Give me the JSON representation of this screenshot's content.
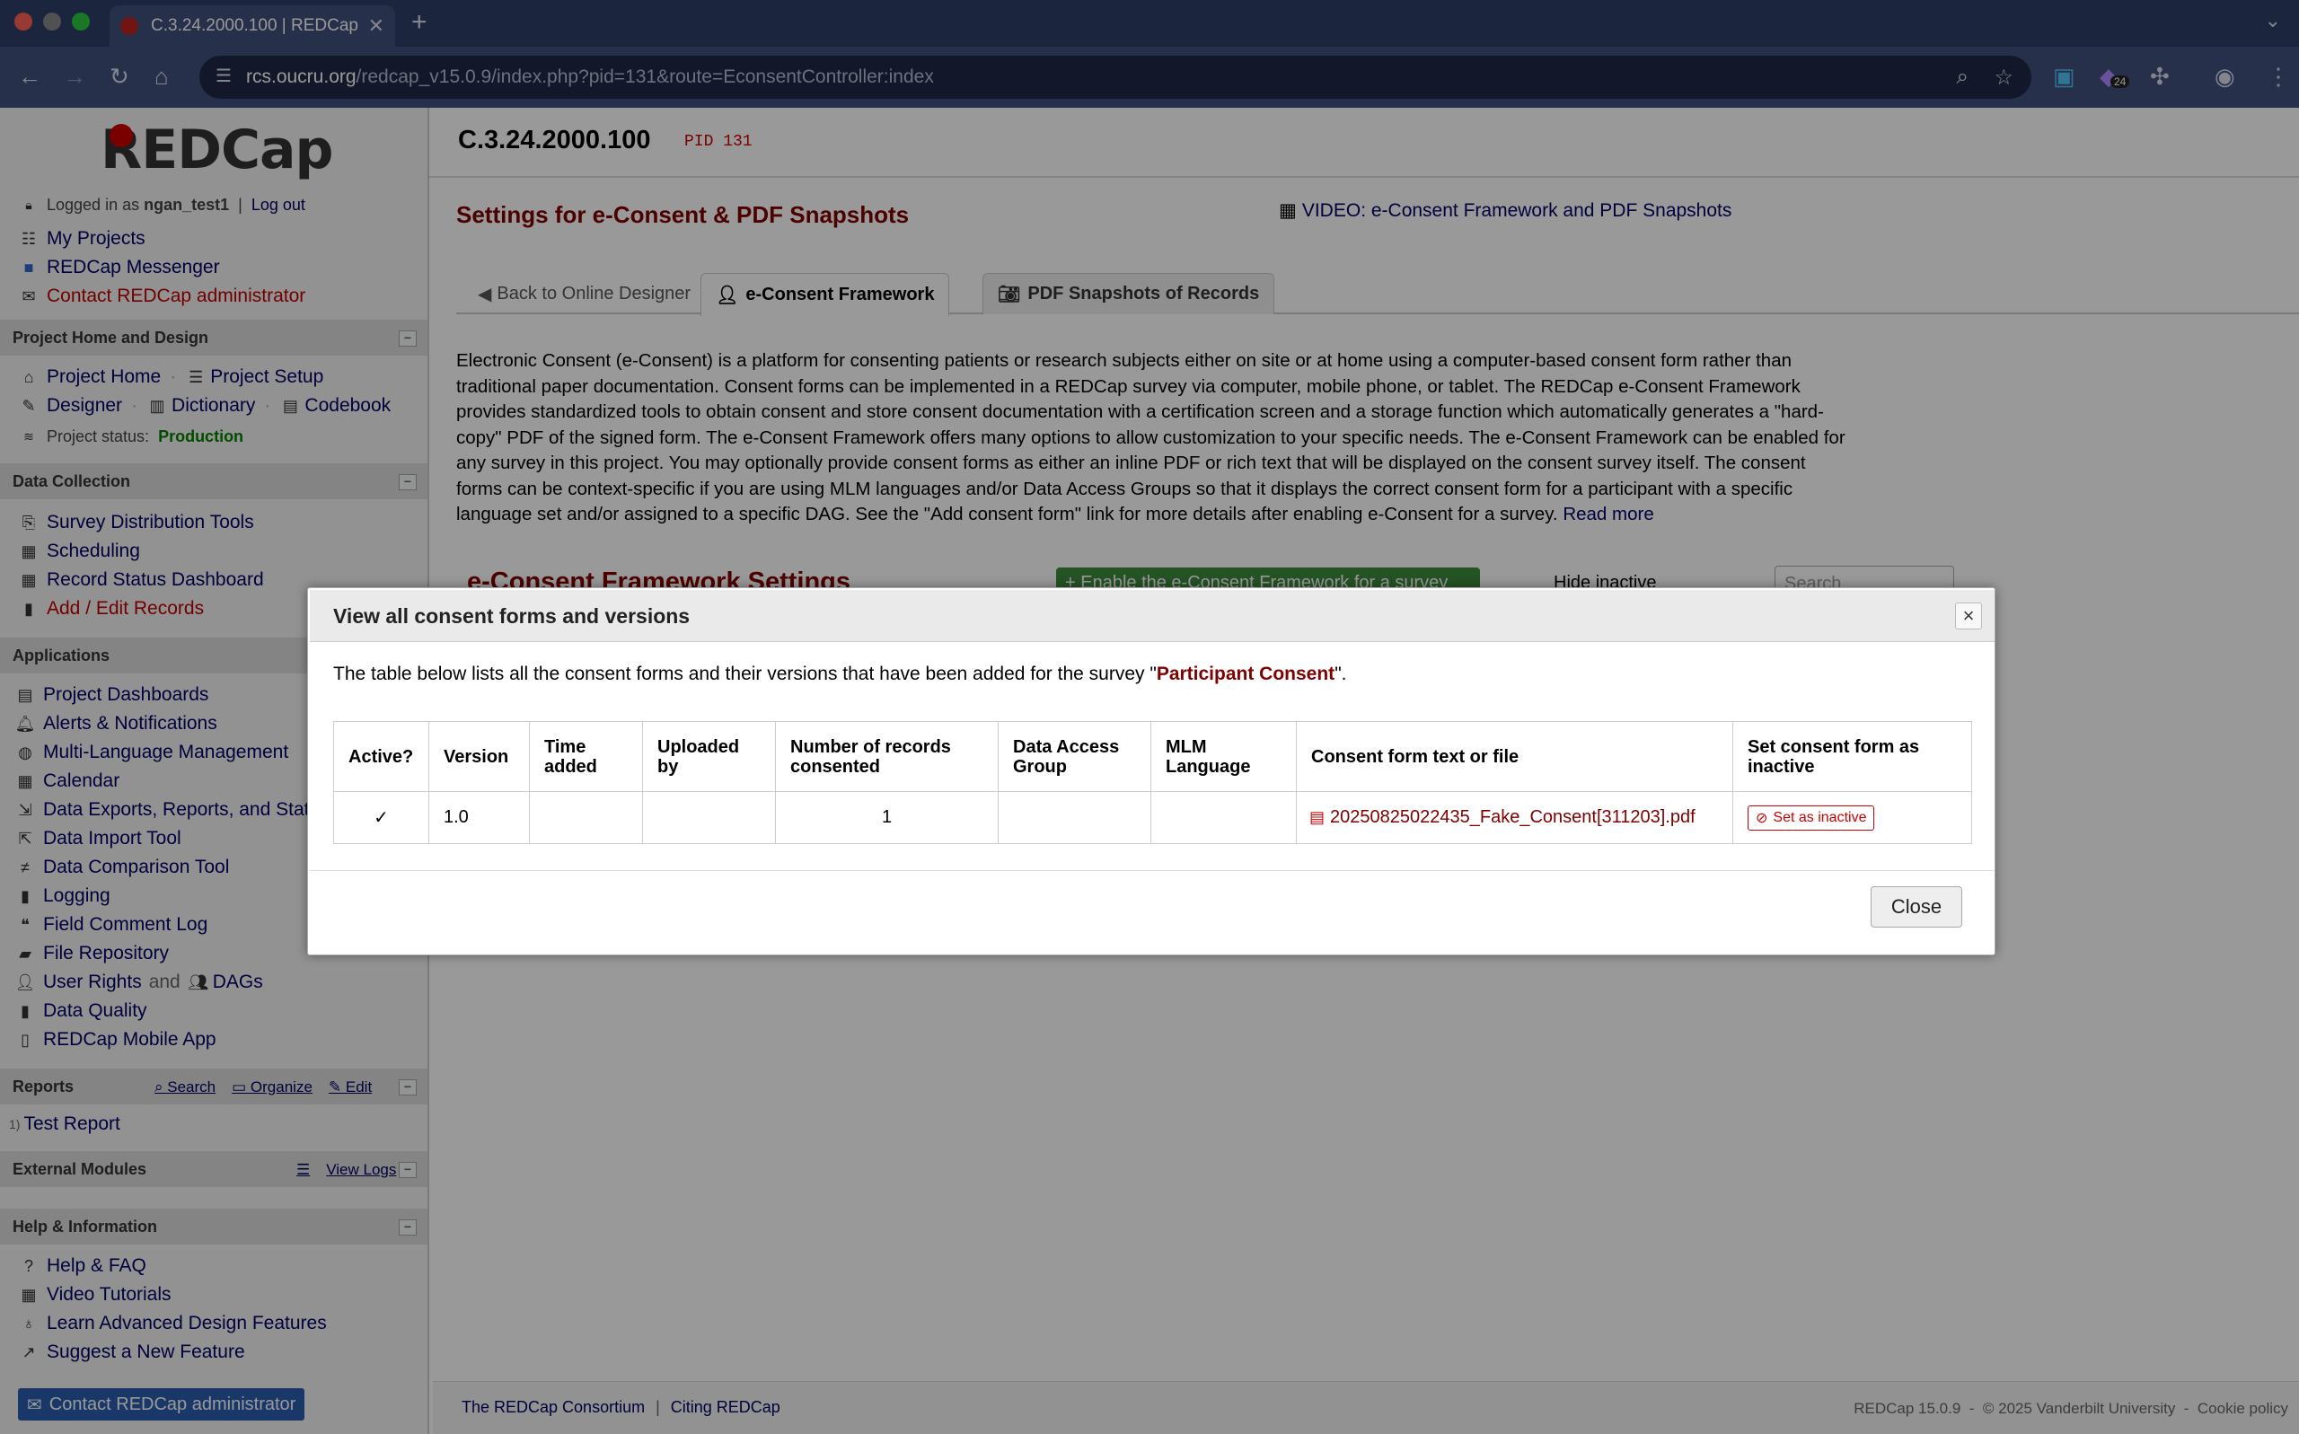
{
  "browser": {
    "tab_title": "C.3.24.2000.100 | REDCap",
    "url_host": "rcs.oucru.org",
    "url_path": "/redcap_v15.0.9/index.php?pid=131&route=EconsentController:index",
    "ext_badge": "24"
  },
  "sidebar": {
    "logo": "REDCap",
    "logged_in_prefix": "Logged in as",
    "username": "ngan_test1",
    "logout": "Log out",
    "top_links": [
      "My Projects",
      "REDCap Messenger",
      "Contact REDCap administrator"
    ],
    "home_head": "Project Home and Design",
    "project_home": "Project Home",
    "project_setup": "Project Setup",
    "designer": "Designer",
    "dictionary": "Dictionary",
    "codebook": "Codebook",
    "status_label": "Project status:",
    "status_value": "Production",
    "data_head": "Data Collection",
    "data_links": [
      "Survey Distribution Tools",
      "Scheduling",
      "Record Status Dashboard",
      "Add / Edit Records"
    ],
    "apps_head": "Applications",
    "app_links": [
      "Project Dashboards",
      "Alerts & Notifications",
      "Multi-Language Management",
      "Calendar",
      "Data Exports, Reports, and Stats",
      "Data Import Tool",
      "Data Comparison Tool",
      "Logging",
      "Field Comment Log",
      "File Repository"
    ],
    "user_rights": "User Rights",
    "and_text": "and",
    "dags": "DAGs",
    "data_quality": "Data Quality",
    "mobile_app": "REDCap Mobile App",
    "reports_head": "Reports",
    "reports_search": "Search",
    "reports_organize": "Organize",
    "reports_edit": "Edit",
    "report_num": "1)",
    "report_item": "Test Report",
    "ext_head": "External Modules",
    "view_logs": "View Logs",
    "help_head": "Help & Information",
    "help_links": [
      "Help & FAQ",
      "Video Tutorials",
      "Learn Advanced Design Features",
      "Suggest a New Feature"
    ],
    "contact_btn": "Contact REDCap administrator"
  },
  "main": {
    "project_title": "C.3.24.2000.100",
    "pid": "PID 131",
    "settings_title": "Settings for e-Consent & PDF Snapshots",
    "video_link": "VIDEO: e-Consent Framework and PDF Snapshots",
    "tabs": [
      "Back to Online Designer",
      "e-Consent Framework",
      "PDF Snapshots of Records"
    ],
    "intro": "Electronic Consent (e-Consent) is a platform for consenting patients or research subjects either on site or at home using a computer-based consent form rather than traditional paper documentation. Consent forms can be implemented in a REDCap survey via computer, mobile phone, or tablet. The REDCap e-Consent Framework provides standardized tools to obtain consent and store consent documentation with a certification screen and a storage function which automatically generates a \"hard-copy\" PDF of the signed form. The e-Consent Framework offers many options to allow customization to your specific needs. The e-Consent Framework can be enabled for any survey in this project. You may optionally provide consent forms as either an inline PDF or rich text that will be displayed on the consent survey itself. The consent forms can be context-specific if you are using MLM languages and/or Data Access Groups so that it displays the correct consent form for a participant with a specific language set and/or assigned to a specific DAG. See the \"Add consent form\" link for more details after enabling e-Consent for a survey.",
    "read_more": "Read more",
    "framework_heading": "e-Consent Framework Settings",
    "enable_button": "+ Enable the e-Consent Framework for a survey",
    "hide_inactive": "Hide inactive",
    "search_placeholder": "Search"
  },
  "footer": {
    "consortium": "The REDCap Consortium",
    "citing": "Citing REDCap",
    "version": "REDCap 15.0.9",
    "copyright": "© 2025 Vanderbilt University",
    "cookie": "Cookie policy"
  },
  "dialog": {
    "title": "View all consent forms and versions",
    "intro_prefix": "The table below lists all the consent forms and their versions that have been added for the survey \"",
    "survey_name": "Participant Consent",
    "intro_suffix": "\".",
    "columns": [
      "Active?",
      "Version",
      "Time added",
      "Uploaded by",
      "Number of records consented",
      "Data Access Group",
      "MLM Language",
      "Consent form text or file",
      "Set consent form as inactive"
    ],
    "rows": [
      {
        "active": "✓",
        "version": "1.0",
        "time_added": "",
        "uploaded_by": "",
        "records": "1",
        "dag": "",
        "mlm": "",
        "file": "20250825022435_Fake_Consent[311203].pdf",
        "action": "Set as inactive"
      }
    ],
    "close": "Close"
  }
}
